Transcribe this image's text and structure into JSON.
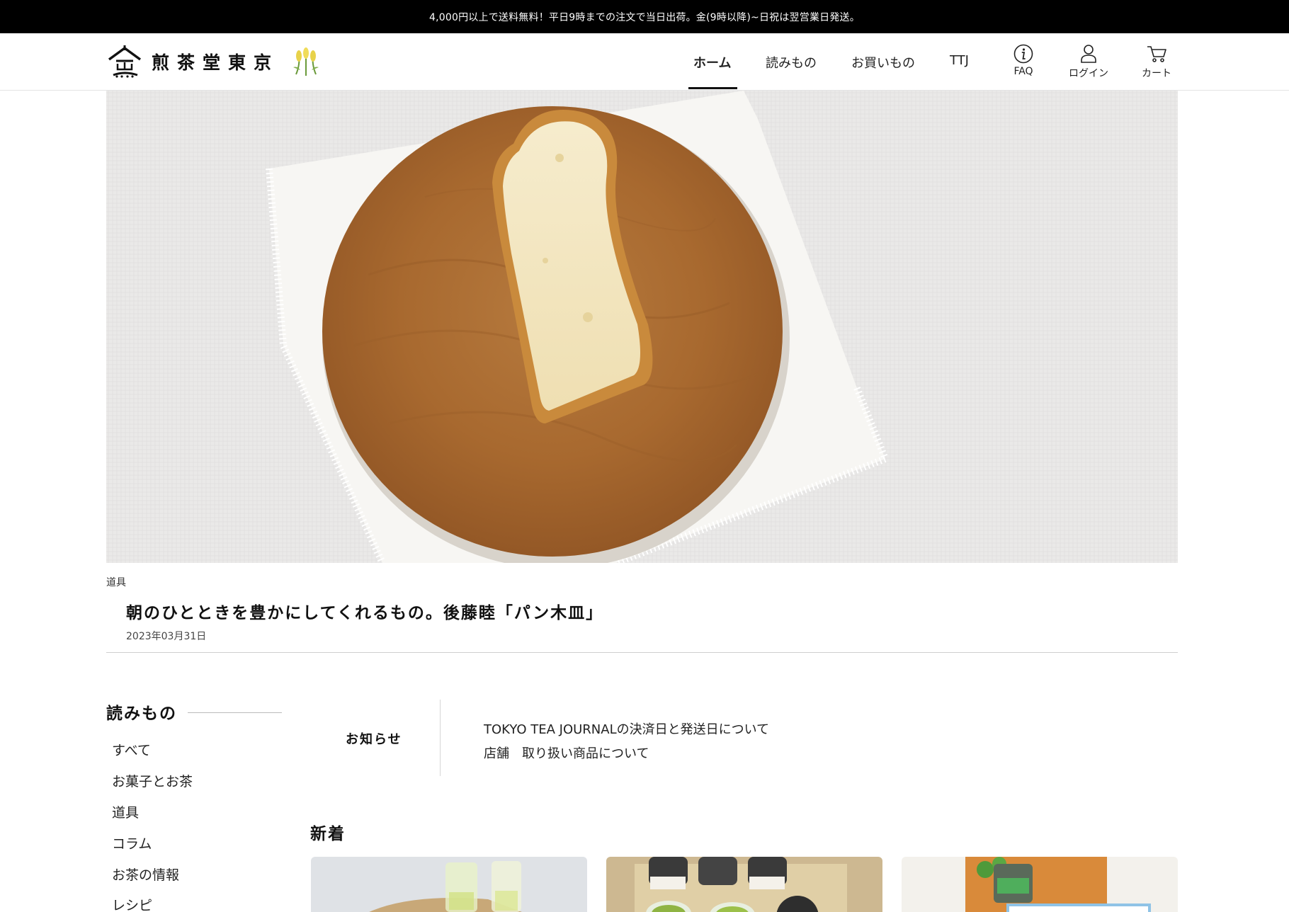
{
  "announcement": "4,000円以上で送料無料！平日9時までの注文で当日出荷。金(9時以降)~日祝は翌営業日発送。",
  "brand": {
    "name": "煎茶堂東京",
    "accent_color": "#111111"
  },
  "nav": {
    "items": [
      "ホーム",
      "読みもの",
      "お買いもの",
      "TTJ"
    ],
    "active": "ホーム"
  },
  "utility": {
    "faq": {
      "label": "FAQ",
      "icon": "info-icon"
    },
    "login": {
      "label": "ログイン",
      "icon": "user-icon"
    },
    "cart": {
      "label": "カート",
      "icon": "cart-icon"
    }
  },
  "hero": {
    "category": "道具",
    "title": "朝のひとときを豊かにしてくれるもの。後藤睦「パン木皿」",
    "date": "2023年03月31日"
  },
  "sidebar": {
    "heading": "読みもの",
    "items": [
      "すべて",
      "お菓子とお茶",
      "道具",
      "コラム",
      "お茶の情報",
      "レシピ"
    ]
  },
  "notice": {
    "label": "お知らせ",
    "links": [
      "TOKYO TEA JOURNALの決済日と発送日について",
      "店舗　取り扱い商品について"
    ]
  },
  "new_section": {
    "heading": "新着"
  }
}
